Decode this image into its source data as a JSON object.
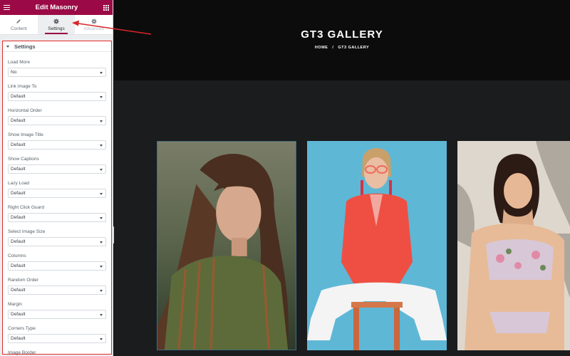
{
  "panel": {
    "title": "Edit Masonry",
    "tabs": [
      {
        "label": "Content",
        "icon": "pencil-icon"
      },
      {
        "label": "Settings",
        "icon": "gear-icon"
      },
      {
        "label": "Advanced",
        "icon": "gear-icon"
      }
    ],
    "section_title": "Settings",
    "fields": [
      {
        "label": "Load More",
        "value": "No"
      },
      {
        "label": "Link Image To",
        "value": "Default"
      },
      {
        "label": "Horizontal Order",
        "value": "Default"
      },
      {
        "label": "Show Image Title",
        "value": "Default"
      },
      {
        "label": "Show Captions",
        "value": "Default"
      },
      {
        "label": "Lazy Load",
        "value": "Default"
      },
      {
        "label": "Right Click Guard",
        "value": "Default"
      },
      {
        "label": "Select Image Size",
        "value": "Default"
      },
      {
        "label": "Columns",
        "value": "Default"
      },
      {
        "label": "Random Order",
        "value": "Default"
      },
      {
        "label": "Margin",
        "value": "Default"
      },
      {
        "label": "Corners Type",
        "value": "Default"
      },
      {
        "label": "Image Border",
        "value": ""
      }
    ],
    "accent_color": "#9b0a46",
    "highlight_color": "#e02b2b"
  },
  "preview": {
    "title": "GT3 GALLERY",
    "breadcrumb": {
      "home": "HOME",
      "separator": "/",
      "current": "GT3 GALLERY"
    }
  }
}
